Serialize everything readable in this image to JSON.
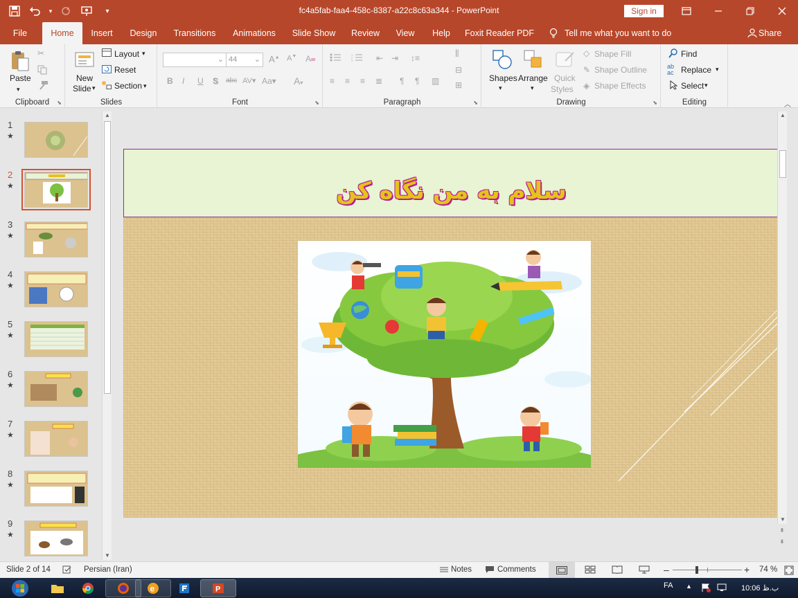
{
  "window": {
    "doc_title": "fc4a5fab-faa4-458c-8387-a22c8c63a344  -  PowerPoint",
    "sign_in": "Sign in"
  },
  "tabs": [
    {
      "label": "File"
    },
    {
      "label": "Home"
    },
    {
      "label": "Insert"
    },
    {
      "label": "Design"
    },
    {
      "label": "Transitions"
    },
    {
      "label": "Animations"
    },
    {
      "label": "Slide Show"
    },
    {
      "label": "Review"
    },
    {
      "label": "View"
    },
    {
      "label": "Help"
    },
    {
      "label": "Foxit Reader PDF"
    }
  ],
  "tell_me": "Tell me what you want to do",
  "share": "Share",
  "ribbon": {
    "clipboard": {
      "label": "Clipboard",
      "paste": "Paste"
    },
    "slides": {
      "label": "Slides",
      "new_slide_1": "New",
      "new_slide_2": "Slide",
      "layout": "Layout",
      "reset": "Reset",
      "section": "Section"
    },
    "font": {
      "label": "Font",
      "size": "44"
    },
    "paragraph": {
      "label": "Paragraph"
    },
    "drawing": {
      "label": "Drawing",
      "shapes": "Shapes",
      "arrange": "Arrange",
      "quick_styles_1": "Quick",
      "quick_styles_2": "Styles",
      "shape_fill": "Shape Fill",
      "shape_outline": "Shape Outline",
      "shape_effects": "Shape Effects"
    },
    "editing": {
      "label": "Editing",
      "find": "Find",
      "replace": "Replace",
      "select": "Select"
    }
  },
  "thumbnails": [
    {
      "num": "1"
    },
    {
      "num": "2"
    },
    {
      "num": "3"
    },
    {
      "num": "4"
    },
    {
      "num": "5"
    },
    {
      "num": "6"
    },
    {
      "num": "7"
    },
    {
      "num": "8"
    },
    {
      "num": "9"
    }
  ],
  "slide": {
    "title": "سلام به من نگاه کن"
  },
  "status": {
    "slide_info": "Slide 2 of 14",
    "language": "Persian (Iran)",
    "notes": "Notes",
    "comments": "Comments",
    "zoom": "74 %"
  },
  "tray": {
    "lang": "FA",
    "time": "10:06 ب.ظ"
  },
  "colors": {
    "accent": "#b7472a",
    "slide_title_fill": "#e6c21a",
    "slide_title_outline": "#b51e9a",
    "title_box_bg": "#e8f4d3"
  }
}
